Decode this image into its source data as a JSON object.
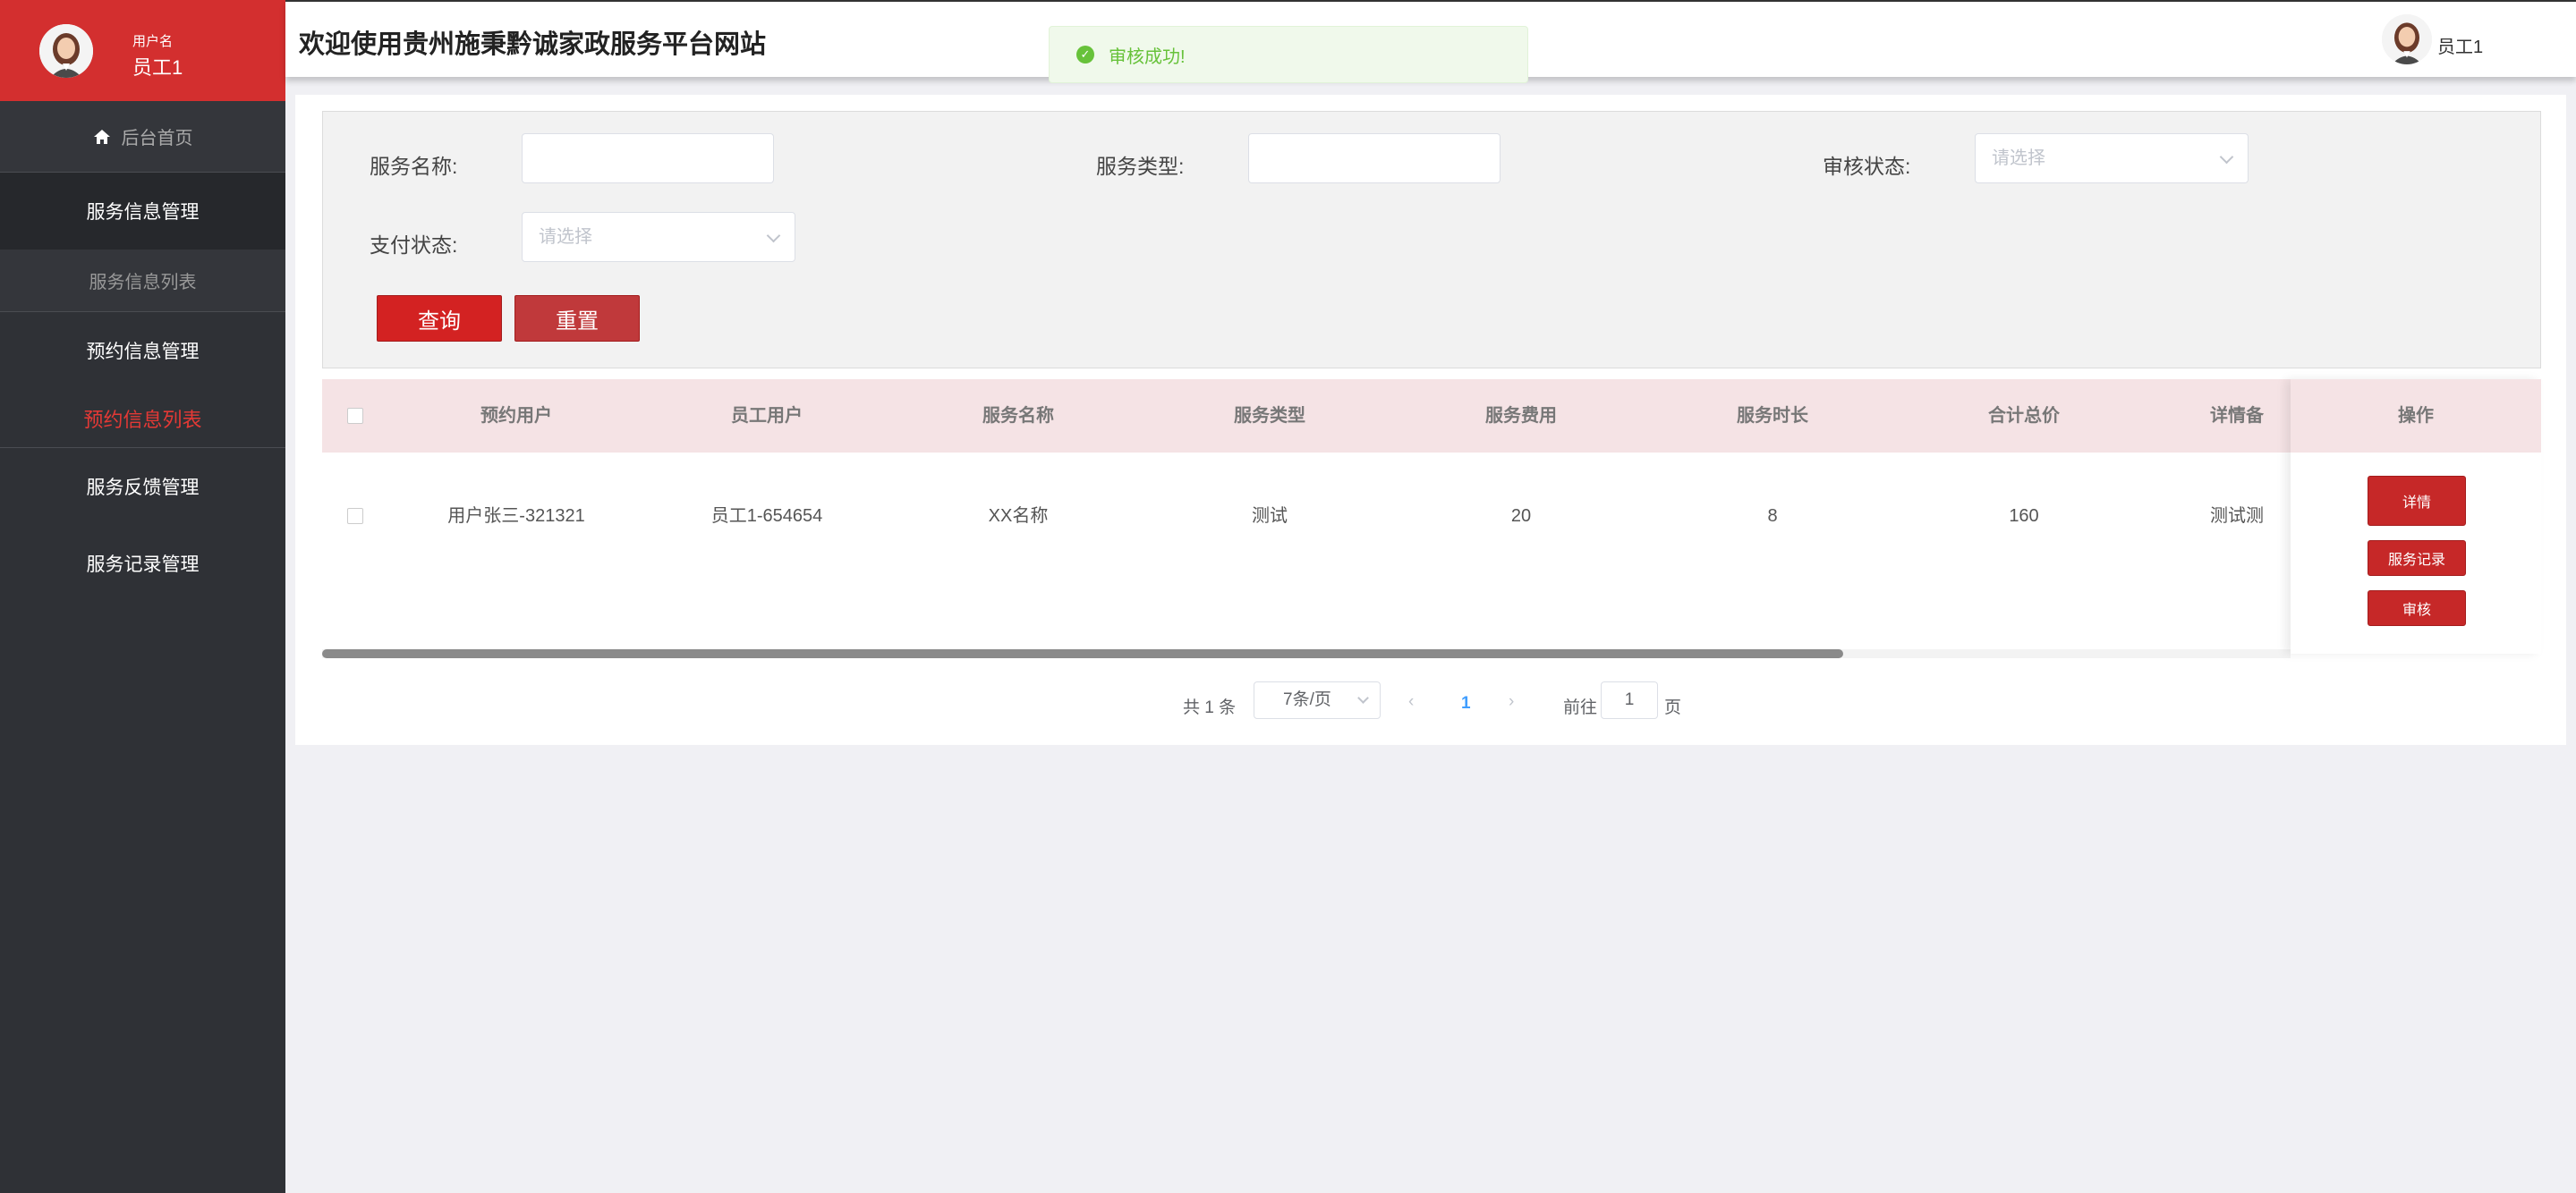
{
  "sidebar": {
    "user_role": "用户名",
    "user_name": "员工1",
    "home": "后台首页",
    "groups": [
      {
        "label": "服务信息管理",
        "sub": "服务信息列表"
      },
      {
        "label": "预约信息管理",
        "sub": "预约信息列表"
      },
      {
        "label": "服务反馈管理"
      },
      {
        "label": "服务记录管理"
      }
    ]
  },
  "header": {
    "title": "欢迎使用贵州施秉黔诚家政服务平台网站",
    "user": "员工1"
  },
  "toast": {
    "message": "审核成功!",
    "color": "#67c23a"
  },
  "filter": {
    "service_name_label": "服务名称:",
    "service_type_label": "服务类型:",
    "audit_status_label": "审核状态:",
    "audit_status_placeholder": "请选择",
    "pay_status_label": "支付状态:",
    "pay_status_placeholder": "请选择",
    "query_button": "查询",
    "reset_button": "重置"
  },
  "table": {
    "headers": [
      "预约用户",
      "员工用户",
      "服务名称",
      "服务类型",
      "服务费用",
      "服务时长",
      "合计总价",
      "详情备",
      "操作"
    ],
    "rows": [
      {
        "booking_user": "用户张三-321321",
        "staff_user": "员工1-654654",
        "service_name": "XX名称",
        "service_type": "测试",
        "service_fee": "20",
        "service_duration": "8",
        "total_price": "160",
        "detail_note": "测试测"
      }
    ],
    "row_actions": [
      "详情",
      "服务记录",
      "审核"
    ]
  },
  "pagination": {
    "total": "共 1 条",
    "page_size": "7条/页",
    "current_page": "1",
    "goto_label": "前往",
    "goto_value": "1",
    "page_unit": "页"
  },
  "colors": {
    "brand_red": "#d32f2f",
    "sidebar_bg": "#2f3136",
    "active_nav": "#e53935",
    "table_header_bg": "#f5e3e5"
  }
}
